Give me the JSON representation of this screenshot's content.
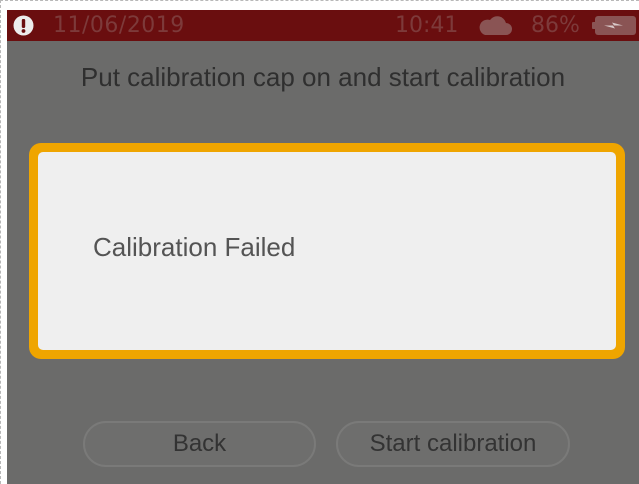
{
  "status_bar": {
    "date": "11/06/2019",
    "time": "10:41",
    "battery_percent": "86%",
    "icons": [
      "alert-icon",
      "cloud-icon",
      "battery-charging-icon"
    ],
    "background_color": "#6a0e0f"
  },
  "instruction": {
    "text": "Put calibration cap on and start calibration"
  },
  "dialog": {
    "message": "Calibration Failed",
    "border_color": "#efa500"
  },
  "buttons": {
    "back_label": "Back",
    "start_label": "Start calibration"
  }
}
